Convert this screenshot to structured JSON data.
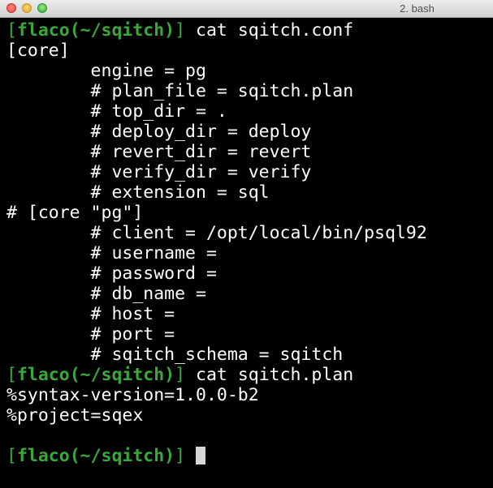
{
  "window": {
    "title": "2. bash"
  },
  "prompt": {
    "open_bracket": "[",
    "user": "flaco",
    "path": "(~/sqitch)",
    "close_bracket": "]"
  },
  "lines": [
    {
      "type": "prompt",
      "command": " cat sqitch.conf"
    },
    {
      "type": "output",
      "text": "[core]"
    },
    {
      "type": "output",
      "text": "        engine = pg"
    },
    {
      "type": "output",
      "text": "        # plan_file = sqitch.plan"
    },
    {
      "type": "output",
      "text": "        # top_dir = ."
    },
    {
      "type": "output",
      "text": "        # deploy_dir = deploy"
    },
    {
      "type": "output",
      "text": "        # revert_dir = revert"
    },
    {
      "type": "output",
      "text": "        # verify_dir = verify"
    },
    {
      "type": "output",
      "text": "        # extension = sql"
    },
    {
      "type": "output",
      "text": "# [core \"pg\"]"
    },
    {
      "type": "output",
      "text": "        # client = /opt/local/bin/psql92"
    },
    {
      "type": "output",
      "text": "        # username ="
    },
    {
      "type": "output",
      "text": "        # password ="
    },
    {
      "type": "output",
      "text": "        # db_name ="
    },
    {
      "type": "output",
      "text": "        # host ="
    },
    {
      "type": "output",
      "text": "        # port ="
    },
    {
      "type": "output",
      "text": "        # sqitch_schema = sqitch"
    },
    {
      "type": "prompt",
      "command": " cat sqitch.plan"
    },
    {
      "type": "output",
      "text": "%syntax-version=1.0.0-b2"
    },
    {
      "type": "output",
      "text": "%project=sqex"
    },
    {
      "type": "output",
      "text": ""
    },
    {
      "type": "prompt",
      "command": " "
    }
  ],
  "colors": {
    "background": "#000000",
    "foreground": "#ffffff",
    "prompt": "#3ba83b",
    "cursor": "#d6d6d6"
  }
}
